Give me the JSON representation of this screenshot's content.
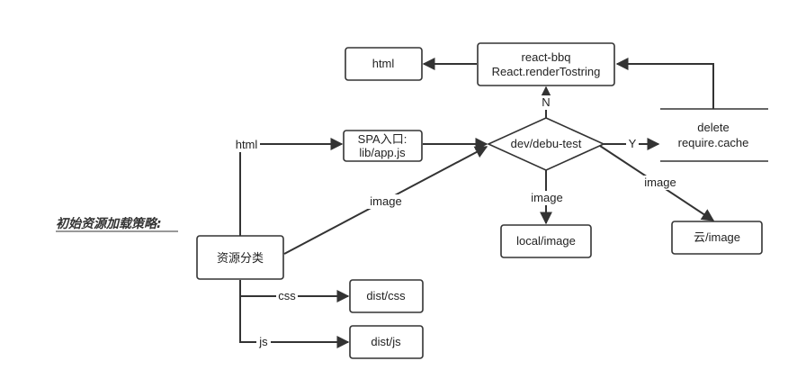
{
  "title": "初始资源加载策略:",
  "nodes": {
    "html_box": {
      "label": "html"
    },
    "render": {
      "line1": "react-bbq",
      "line2": "React.renderTostring"
    },
    "spa": {
      "line1": "SPA入口:",
      "line2": "lib/app.js"
    },
    "decision": {
      "label": "dev/debu-test"
    },
    "cache": {
      "line1": "delete",
      "line2": "require.cache"
    },
    "local_image": {
      "label": "local/image"
    },
    "cloud_image": {
      "label": "云/image"
    },
    "classify": {
      "label": "资源分类"
    },
    "dist_css": {
      "label": "dist/css"
    },
    "dist_js": {
      "label": "dist/js"
    }
  },
  "edges": {
    "html": "html",
    "image_classify": "image",
    "n": "N",
    "y": "Y",
    "image_local": "image",
    "image_cloud": "image",
    "css": "css",
    "js": "js"
  }
}
